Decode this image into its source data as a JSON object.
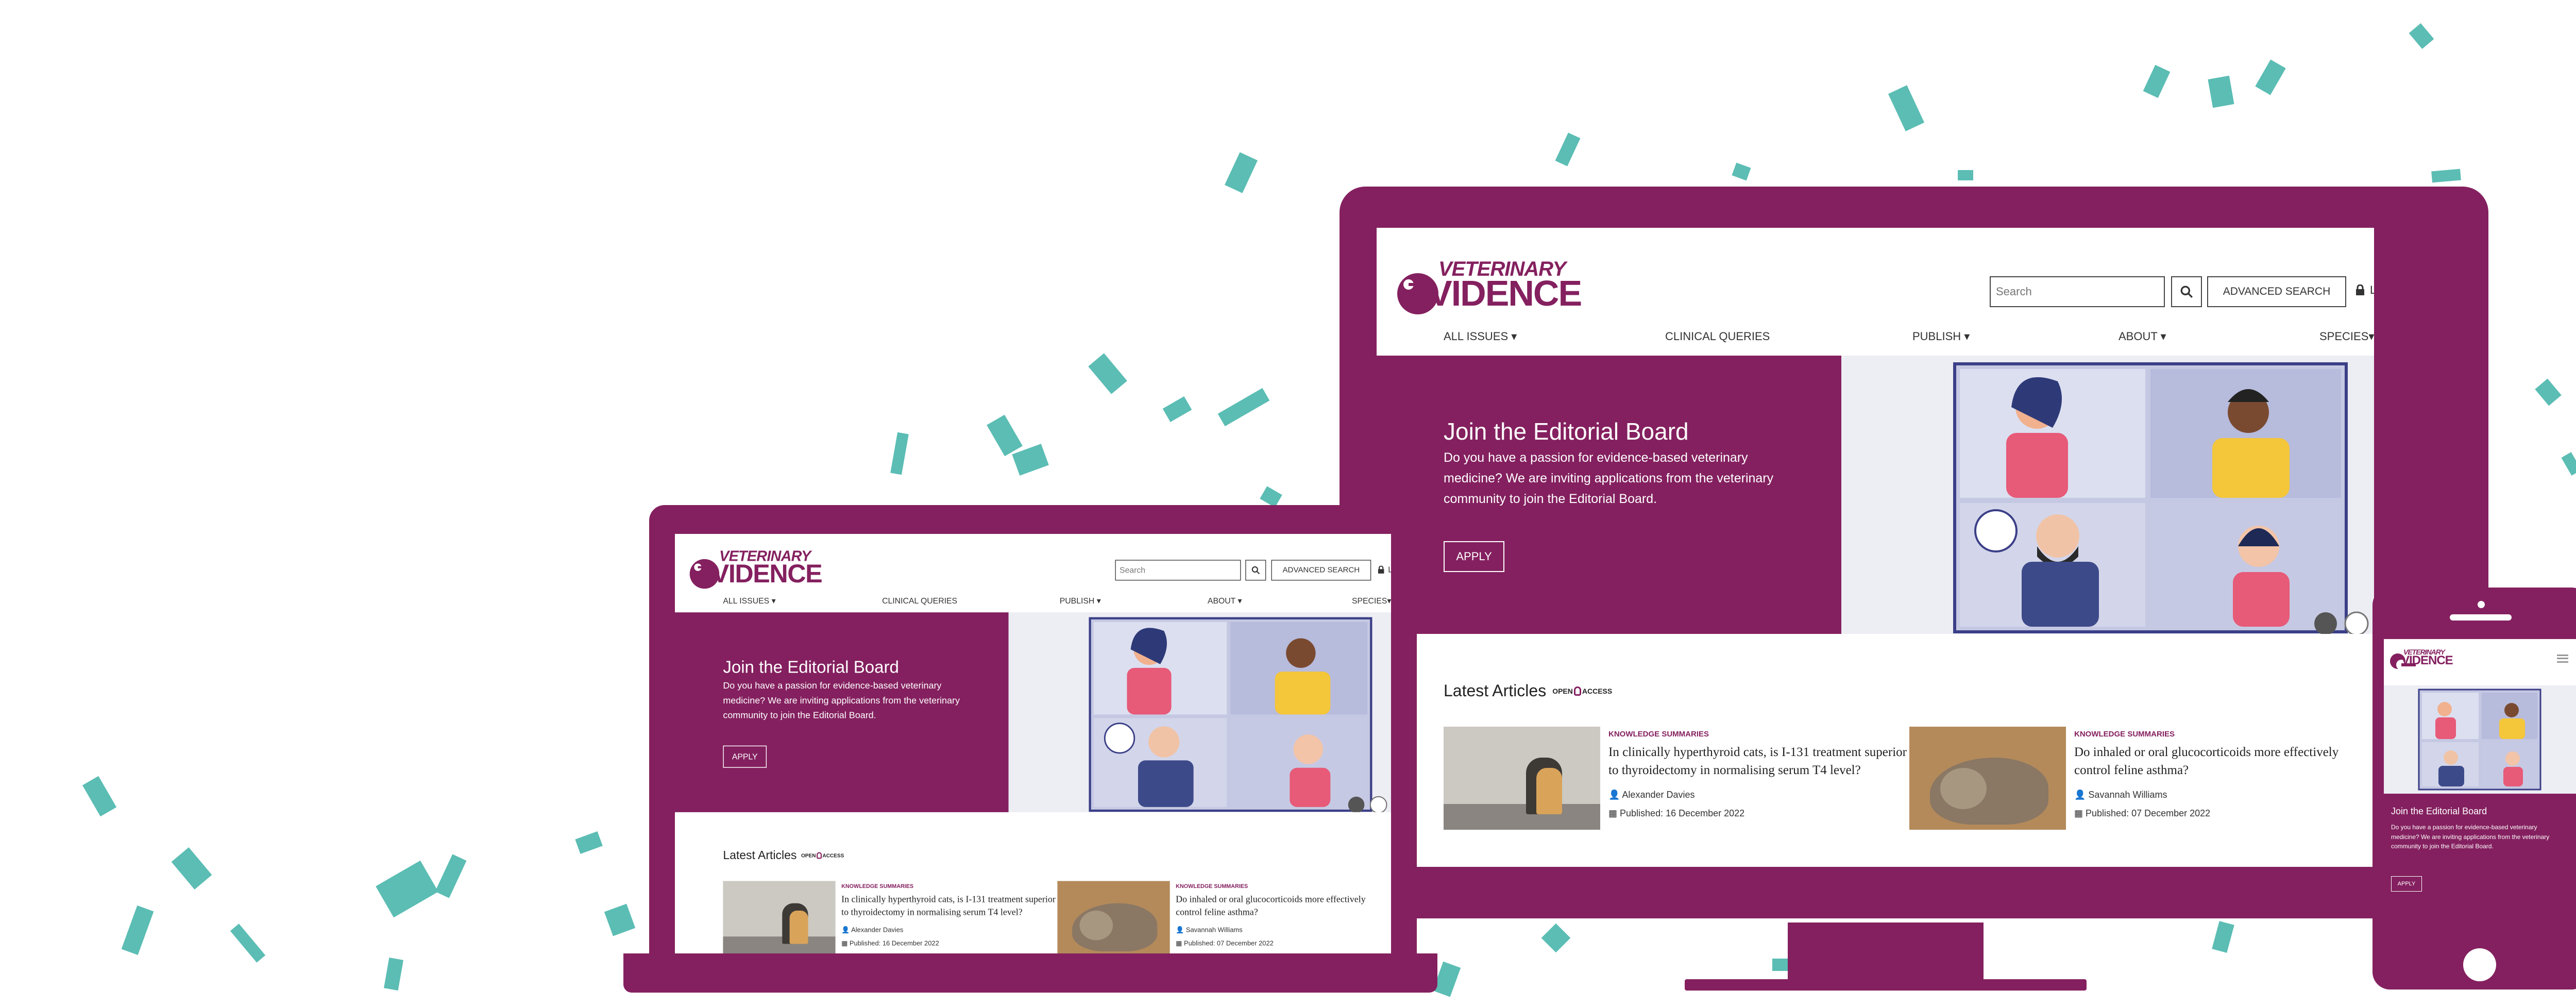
{
  "brand": {
    "logo_top": "VETERINARY",
    "logo_bottom": "VIDENCE",
    "primary": "#84205f",
    "accent": "#5bbdb4"
  },
  "header": {
    "search_placeholder": "Search",
    "advanced_search": "ADVANCED SEARCH",
    "login": "Login"
  },
  "nav": {
    "all_issues": "ALL ISSUES",
    "clinical_queries": "CLINICAL QUERIES",
    "publish": "PUBLISH",
    "about": "ABOUT",
    "species": "SPECIES"
  },
  "hero": {
    "title": "Join the Editorial Board",
    "text": "Do you have a passion for evidence-based veterinary medicine? We are inviting applications from the veterinary community to join the Editorial Board.",
    "button": "APPLY"
  },
  "latest": {
    "title": "Latest Articles",
    "badge_open": "OPEN",
    "badge_access": "ACCESS",
    "articles": [
      {
        "category": "KNOWLEDGE SUMMARIES",
        "title": "In clinically hyperthyroid cats, is I-131 treatment superior to thyroidectomy in normalising serum T4 level?",
        "author": "Alexander Davies",
        "published": "Published: 16 December 2022"
      },
      {
        "category": "KNOWLEDGE SUMMARIES",
        "title": "Do inhaled or oral glucocorticoids more effectively control feline asthma?",
        "author": "Savannah Williams",
        "published": "Published: 07 December 2022"
      }
    ]
  },
  "mobile": {
    "menu_icon": "hamburger-icon"
  }
}
